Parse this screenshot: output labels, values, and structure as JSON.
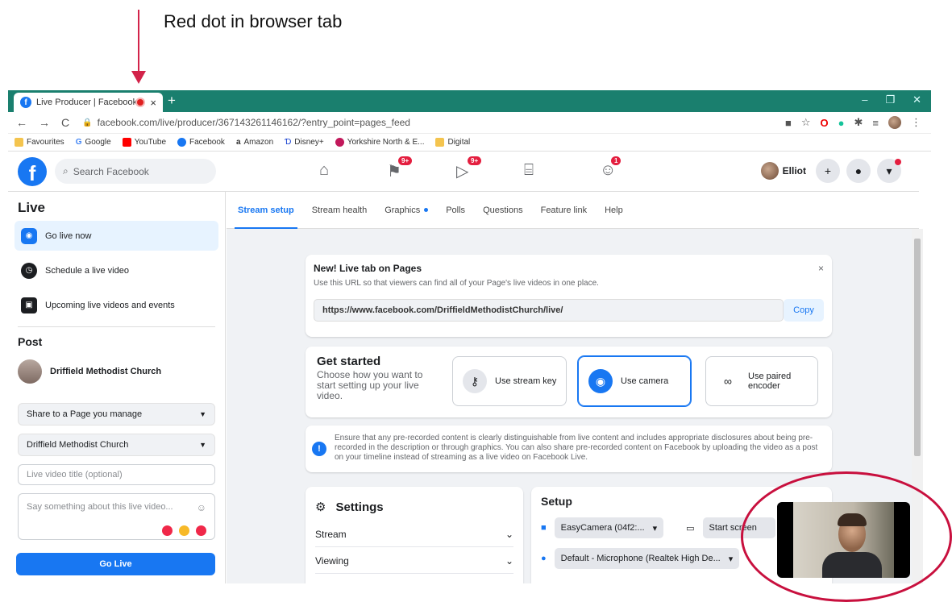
{
  "annotation": {
    "text": "Red dot in browser tab"
  },
  "browser": {
    "tab_title": "Live Producer | Facebook",
    "url": "facebook.com/live/producer/367143261146162/?entry_point=pages_feed",
    "bookmarks": [
      "Favourites",
      "Google",
      "YouTube",
      "Facebook",
      "Amazon",
      "Disney+",
      "Yorkshire North & E...",
      "Digital"
    ]
  },
  "facebook": {
    "search_placeholder": "Search Facebook",
    "badges": {
      "pages": "9+",
      "watch": "9+",
      "groups": "1"
    },
    "profile_name": "Elliot"
  },
  "sidebar": {
    "live_heading": "Live",
    "items": [
      {
        "label": "Go live now",
        "icon": "camera-icon"
      },
      {
        "label": "Schedule a live video",
        "icon": "clock-icon"
      },
      {
        "label": "Upcoming live videos and events",
        "icon": "calendar-icon"
      }
    ],
    "post_heading": "Post",
    "page_name": "Driffield Methodist Church",
    "share_select": "Share to a Page you manage",
    "page_select": "Driffield Methodist Church",
    "title_placeholder": "Live video title (optional)",
    "desc_placeholder": "Say something about this live video...",
    "go_live": "Go Live"
  },
  "tabs": [
    "Stream setup",
    "Stream health",
    "Graphics",
    "Polls",
    "Questions",
    "Feature link",
    "Help"
  ],
  "new_tab_card": {
    "title": "New! Live tab on Pages",
    "text": "Use this URL so that viewers can find all of your Page's live videos in one place.",
    "url": "https://www.facebook.com/DriffieldMethodistChurch/live/",
    "copy": "Copy"
  },
  "get_started": {
    "title": "Get started",
    "subtitle": "Choose how you want to start setting up your live video.",
    "options": [
      "Use stream key",
      "Use camera",
      "Use paired encoder"
    ]
  },
  "notice": {
    "text": "Ensure that any pre-recorded content is clearly distinguishable from live content and includes appropriate disclosures about being pre-recorded in the description or through graphics. You can also share pre-recorded content on Facebook by uploading the video as a post on your timeline instead of streaming as a live video on Facebook Live."
  },
  "settings": {
    "title": "Settings",
    "rows": [
      "Stream",
      "Viewing"
    ]
  },
  "setup": {
    "title": "Setup",
    "camera": "EasyCamera (04f2:...",
    "screen_button": "Start screen",
    "mic": "Default - Microphone (Realtek High De..."
  },
  "colors": {
    "brand": "#1877f2",
    "annotation": "#d3234a",
    "tabstrip": "#1a7f6e"
  }
}
